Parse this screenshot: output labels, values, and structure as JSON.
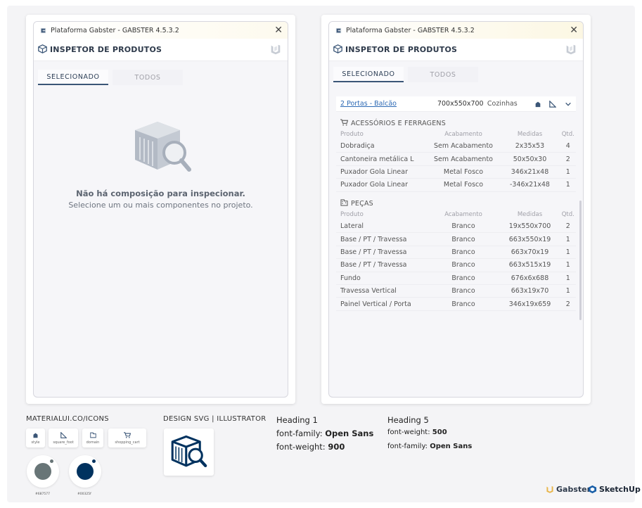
{
  "colors": {
    "primary": "#3b5677",
    "swatch_gray": "#687577",
    "swatch_blue": "#00325f",
    "link": "#2d6ab5",
    "titlebar_right": "#fcf7e3"
  },
  "left_window": {
    "title": "Plataforma Gabster - GABSTER 4.5.3.2",
    "header": "INSPETOR DE PRODUTOS",
    "tabs": [
      "SELECIONADO",
      "TODOS"
    ],
    "empty_title": "Não há composição para inspecionar.",
    "empty_subtitle": "Selecione um ou mais componentes no projeto."
  },
  "right_window": {
    "title": "Plataforma Gabster - GABSTER 4.5.3.2",
    "header": "INSPETOR DE PRODUTOS",
    "tabs": [
      "SELECIONADO",
      "TODOS"
    ],
    "product": {
      "name": "2 Portas - Balcão",
      "dimensions": "700x550x700",
      "category": "Cozinhas"
    },
    "columns": [
      "Produto",
      "Acabamento",
      "Medidas",
      "Qtd."
    ],
    "sections": [
      {
        "title": "ACESSÓRIOS E FERRAGENS",
        "icon": "shopping-cart-icon",
        "rows": [
          [
            "Dobradiça",
            "Sem Acabamento",
            "2x35x53",
            "4"
          ],
          [
            "Cantoneira metálica L",
            "Sem Acabamento",
            "50x50x30",
            "2"
          ],
          [
            "Puxador Gola Linear",
            "Metal Fosco",
            "346x21x48",
            "1"
          ],
          [
            "Puxador Gola Linear",
            "Metal Fosco",
            "-346x21x48",
            "1"
          ]
        ]
      },
      {
        "title": "PEÇAS",
        "icon": "domain-icon",
        "rows": [
          [
            "Lateral",
            "Branco",
            "19x550x700",
            "2"
          ],
          [
            "Base / PT / Travessa",
            "Branco",
            "663x550x19",
            "1"
          ],
          [
            "Base / PT / Travessa",
            "Branco",
            "663x70x19",
            "1"
          ],
          [
            "Base / PT / Travessa",
            "Branco",
            "663x515x19",
            "1"
          ],
          [
            "Fundo",
            "Branco",
            "676x6x688",
            "1"
          ],
          [
            "Travessa Vertical",
            "Branco",
            "663x19x70",
            "1"
          ],
          [
            "Painel Vertical / Porta",
            "Branco",
            "346x19x659",
            "2"
          ]
        ]
      }
    ]
  },
  "footer": {
    "materialui_label": "MATERIALUI.CO/ICONS",
    "icons": [
      {
        "name": "style",
        "icon": "style-icon"
      },
      {
        "name": "square_foot",
        "icon": "square-foot-icon"
      },
      {
        "name": "domain",
        "icon": "domain-icon"
      },
      {
        "name": "shopping_cart",
        "icon": "shopping-cart-icon"
      }
    ],
    "swatches": [
      "#687577",
      "#00325f"
    ],
    "design_label": "DESIGN SVG | ILLUSTRATOR",
    "typography": {
      "h1_title": "Heading 1",
      "h1_family_label": "font-family:",
      "h1_family": "Open Sans",
      "h1_weight_label": "font-weight:",
      "h1_weight": "900",
      "h5_title": "Heading 5",
      "h5_weight_label": "font-weight:",
      "h5_weight": "500",
      "h5_family_label": "font-family:",
      "h5_family": "Open Sans"
    },
    "brands": [
      "Gabster",
      "SketchUp"
    ]
  }
}
